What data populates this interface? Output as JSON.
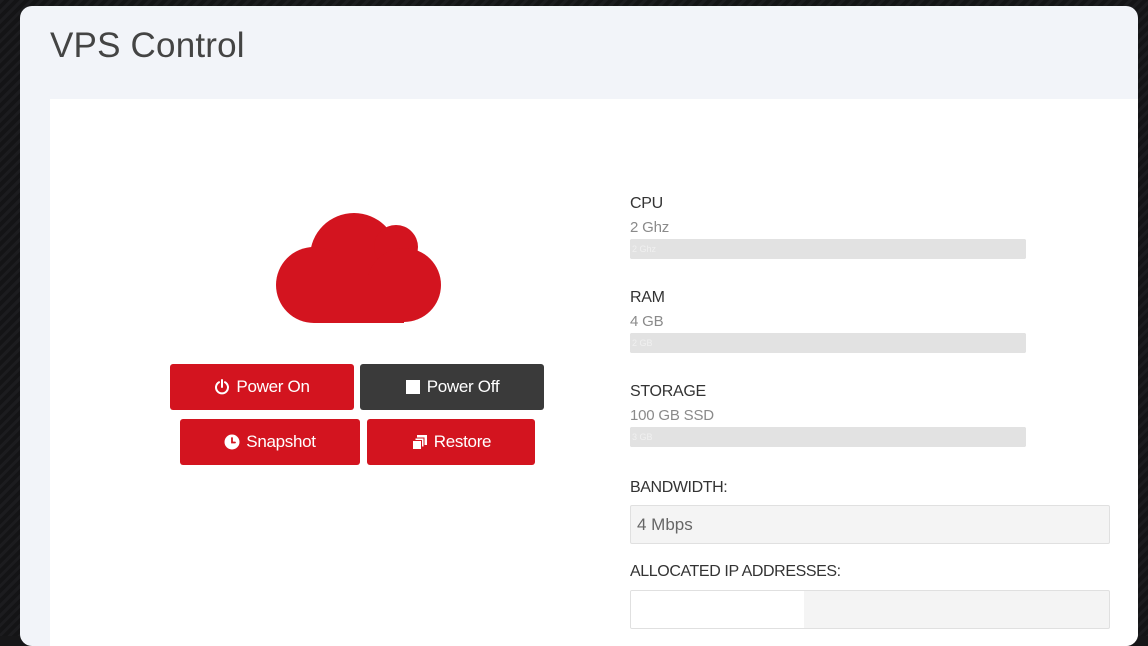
{
  "panel": {
    "title": "VPS Control"
  },
  "status": {
    "icon": "cloud-icon",
    "color": "#d3141f"
  },
  "buttons": {
    "power_on": {
      "label": "Power On",
      "icon": "power-icon",
      "color": "#d3141f"
    },
    "power_off": {
      "label": "Power Off",
      "icon": "stop-square-icon",
      "color": "#3a3a3a"
    },
    "snapshot": {
      "label": "Snapshot",
      "icon": "clock-icon",
      "color": "#d3141f"
    },
    "restore": {
      "label": "Restore",
      "icon": "copy-stack-icon",
      "color": "#d3141f"
    }
  },
  "stats": {
    "cpu": {
      "label": "CPU",
      "value": "2 Ghz",
      "bar_text": "2 Ghz"
    },
    "ram": {
      "label": "RAM",
      "value": "4 GB",
      "bar_text": "2 GB"
    },
    "storage": {
      "label": "STORAGE",
      "value": "100 GB SSD",
      "bar_text": "3 GB"
    }
  },
  "fields": {
    "bandwidth": {
      "label": "BANDWIDTH:",
      "value": "4 Mbps"
    },
    "ip_addresses": {
      "label": "ALLOCATED IP ADDRESSES:",
      "value": ""
    }
  }
}
